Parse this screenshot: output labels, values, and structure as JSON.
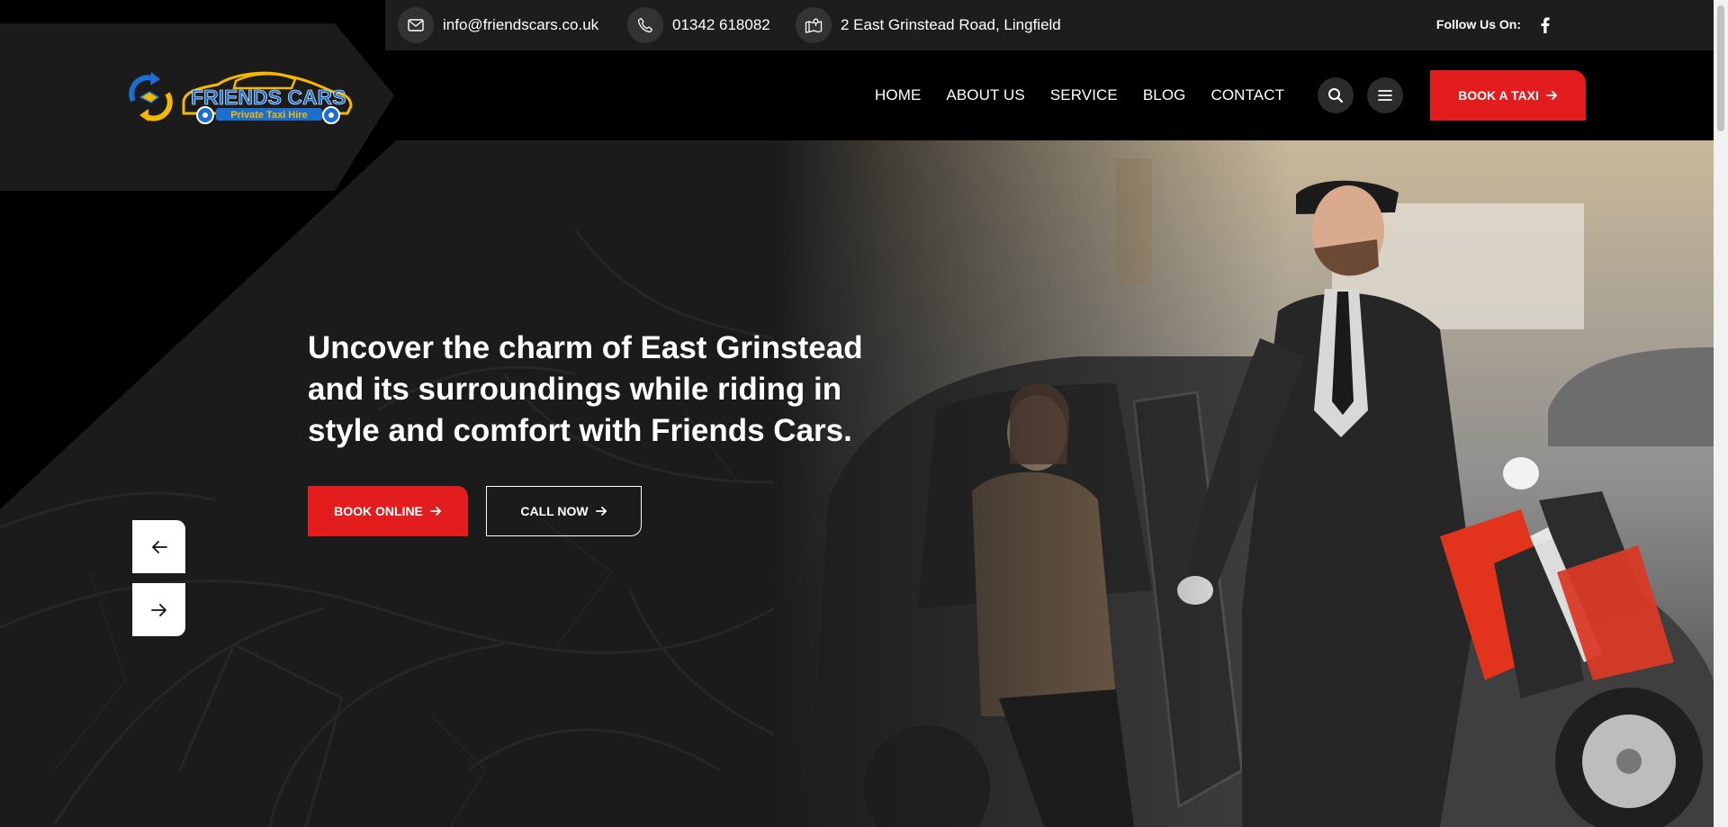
{
  "topbar": {
    "email": "info@friendscars.co.uk",
    "phone": "01342 618082",
    "address": "2 East Grinstead Road, Lingfield",
    "follow_label": "Follow Us On:"
  },
  "brand": {
    "name": "FRIENDS CARS",
    "tagline": "Private Taxi Hire",
    "colors": {
      "accent_red": "#e31d1d",
      "logo_blue": "#1a6fd1",
      "logo_yellow": "#f5b800"
    }
  },
  "nav": {
    "items": [
      "HOME",
      "ABOUT US",
      "SERVICE",
      "BLOG",
      "CONTACT"
    ],
    "book_label": "BOOK A TAXI"
  },
  "hero": {
    "title": "Uncover the charm of East Grinstead and its surroundings while riding in style and comfort with Friends Cars.",
    "book_online_label": "BOOK ONLINE",
    "call_now_label": "CALL NOW"
  },
  "icons": [
    "envelope-icon",
    "phone-icon",
    "map-icon",
    "facebook-icon",
    "search-icon",
    "menu-icon",
    "arrow-right-icon",
    "arrow-left-icon"
  ]
}
